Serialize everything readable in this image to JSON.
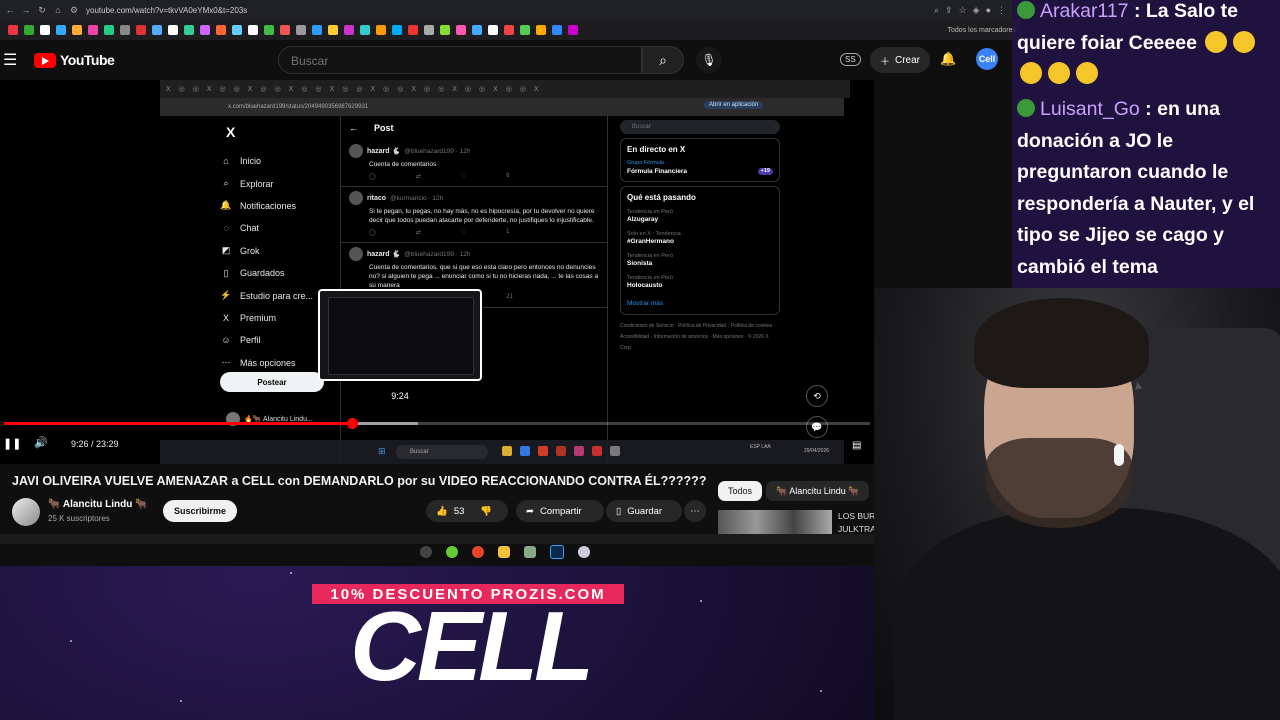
{
  "browser": {
    "url": "youtube.com/watch?v=tkvVA0eYMx0&t=203s",
    "bookmarks_folder": "Todos los marcadores",
    "bookmark_colors": [
      "#e34",
      "#3a3",
      "#fff",
      "#3af",
      "#fa3",
      "#e4a",
      "#2c8",
      "#888",
      "#d33",
      "#5af",
      "#fff",
      "#3c9",
      "#c6f",
      "#f63",
      "#6cf",
      "#fff",
      "#4b4",
      "#e55",
      "#999",
      "#39f",
      "#fc3",
      "#c3c",
      "#3cc",
      "#f90",
      "#0af",
      "#e33",
      "#aaa",
      "#8d3",
      "#f5a",
      "#4af",
      "#fff",
      "#e44",
      "#5c5",
      "#fa0",
      "#38f",
      "#c0c"
    ]
  },
  "youtube": {
    "logo_text": "YouTube",
    "search_placeholder": "Buscar",
    "ss_badge": "SS",
    "create_label": "Crear",
    "avatar_text": "Cell"
  },
  "player": {
    "current_time": "9:26",
    "duration": "23:29",
    "time_display": "9:26 / 23:29",
    "hover_time": "9:24",
    "progress_fraction": 0.4013,
    "buffer_fraction": 0.478
  },
  "inner_x": {
    "url": "x.com/bluehazard199/status/2049490356987629931",
    "open_app": "Abrir en aplicación",
    "logo": "X",
    "nav": [
      {
        "icon": "⌂",
        "label": "Inicio",
        "name": "home"
      },
      {
        "icon": "⌕",
        "label": "Explorar",
        "name": "explore"
      },
      {
        "icon": "🔔",
        "label": "Notificaciones",
        "name": "notifications"
      },
      {
        "icon": "◌",
        "label": "Chat",
        "name": "chat"
      },
      {
        "icon": "◩",
        "label": "Grok",
        "name": "grok"
      },
      {
        "icon": "▯",
        "label": "Guardados",
        "name": "bookmarks"
      },
      {
        "icon": "⚡",
        "label": "Estudio para cre...",
        "name": "creator-studio"
      },
      {
        "icon": "X",
        "label": "Premium",
        "name": "premium"
      },
      {
        "icon": "☺",
        "label": "Perfil",
        "name": "profile"
      },
      {
        "icon": "⋯",
        "label": "Más opciones",
        "name": "more"
      }
    ],
    "post_button": "Postear",
    "user_label": "🔥🐂 Alancitu Lindu...",
    "post_header": "Post",
    "tweets": [
      {
        "user": "hazard 🐇",
        "handle": "@bluehazard199 · 12h",
        "text": "Cuenta de comentarios",
        "stats": "6"
      },
      {
        "user": "ritaco",
        "handle": "@kurmancio · 12h",
        "text": "Si te pegan, tu pegas, no hay más, no es hipocresía, por tu devolver no quiere decir que todos puedan atacarte por defenderte, no justifiques lo injustificable.",
        "stats": "1"
      },
      {
        "user": "hazard 🐇",
        "handle": "@bluehazard199 · 12h",
        "text": "Cuenta de comentarios. que si que eso esta claro pero entonces no denuncies no? si alguien te pega ... enunciar como si tu no hicieras nada, ... te las cosas a su manera",
        "stats": "21"
      }
    ],
    "search_placeholder": "Buscar",
    "live_title": "En directo en X",
    "live_source": "Grupo Fórmula",
    "live_show": "Fórmula Financiera",
    "live_count": "+19",
    "trends_title": "Qué está pasando",
    "trends": [
      {
        "context": "Tendencia en Perú",
        "topic": "Alzugaray"
      },
      {
        "context": "Solo en X · Tendencia",
        "topic": "#GranHermano"
      },
      {
        "context": "Tendencia en Perú",
        "topic": "Sionista"
      },
      {
        "context": "Tendencia en Perú",
        "topic": "Holocausto"
      }
    ],
    "show_more": "Mostrar más",
    "footer": "Condiciones de Servicio · Política de Privacidad · Política de cookies · Accesibilidad · Información de anuncios · Más opciones · © 2026 X Corp.",
    "taskbar_search": "Buscar",
    "taskbar_lang": "ESP LAA",
    "taskbar_date": "29/04/2026"
  },
  "video": {
    "title": "JAVI OLIVEIRA VUELVE AMENAZAR a CELL con DEMANDARLO por su VIDEO REACCIONANDO CONTRA ÉL??????",
    "channel": "🐂 Alancitu Lindu 🐂",
    "subscribers": "25 K suscriptores",
    "subscribe": "Suscribirme",
    "likes": "53",
    "share": "Compartir",
    "save": "Guardar",
    "chips": [
      "Todos",
      "🐂 Alancitu Lindu 🐂"
    ],
    "rec_title": "LOS BUR JULKTRA"
  },
  "promo": {
    "tagline": "10% DESCUENTO PROZIS.COM",
    "brand": "CELL"
  },
  "chat": [
    {
      "user": "Arakar117",
      "text": "La Salo te quiere foiar Ceeeee"
    },
    {
      "user": "Luisant_Go",
      "text": "en una donación a JO le preguntaron cuando le respondería a Nauter, y el tipo se Jijeo se cago y cambió el tema"
    }
  ]
}
